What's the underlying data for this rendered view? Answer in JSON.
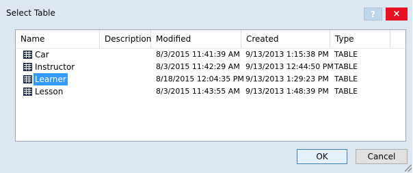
{
  "window": {
    "title": "Select Table",
    "help_label": "?",
    "close_label": "×"
  },
  "table": {
    "columns": [
      "Name",
      "Description",
      "Modified",
      "Created",
      "Type"
    ],
    "rows": [
      {
        "name": "Car",
        "description": "",
        "modified": "8/3/2015 11:41:39 AM",
        "created": "9/13/2013 1:15:38 PM",
        "type": "TABLE",
        "selected": false
      },
      {
        "name": "Instructor",
        "description": "",
        "modified": "8/3/2015 11:42:29 AM",
        "created": "9/13/2013 12:44:50 PM",
        "type": "TABLE",
        "selected": false
      },
      {
        "name": "Learner",
        "description": "",
        "modified": "8/18/2015 12:04:35 PM",
        "created": "9/13/2013 1:29:23 PM",
        "type": "TABLE",
        "selected": true
      },
      {
        "name": "Lesson",
        "description": "",
        "modified": "8/3/2015 11:43:55 AM",
        "created": "9/13/2013 1:48:39 PM",
        "type": "TABLE",
        "selected": false
      }
    ]
  },
  "buttons": {
    "ok": "OK",
    "cancel": "Cancel"
  },
  "icons": {
    "row_icon": "table-icon",
    "help": "help-icon",
    "close": "close-icon"
  },
  "colors": {
    "selection": "#3399ff",
    "close_button": "#e81123",
    "dialog_background": "#dde8f3"
  }
}
